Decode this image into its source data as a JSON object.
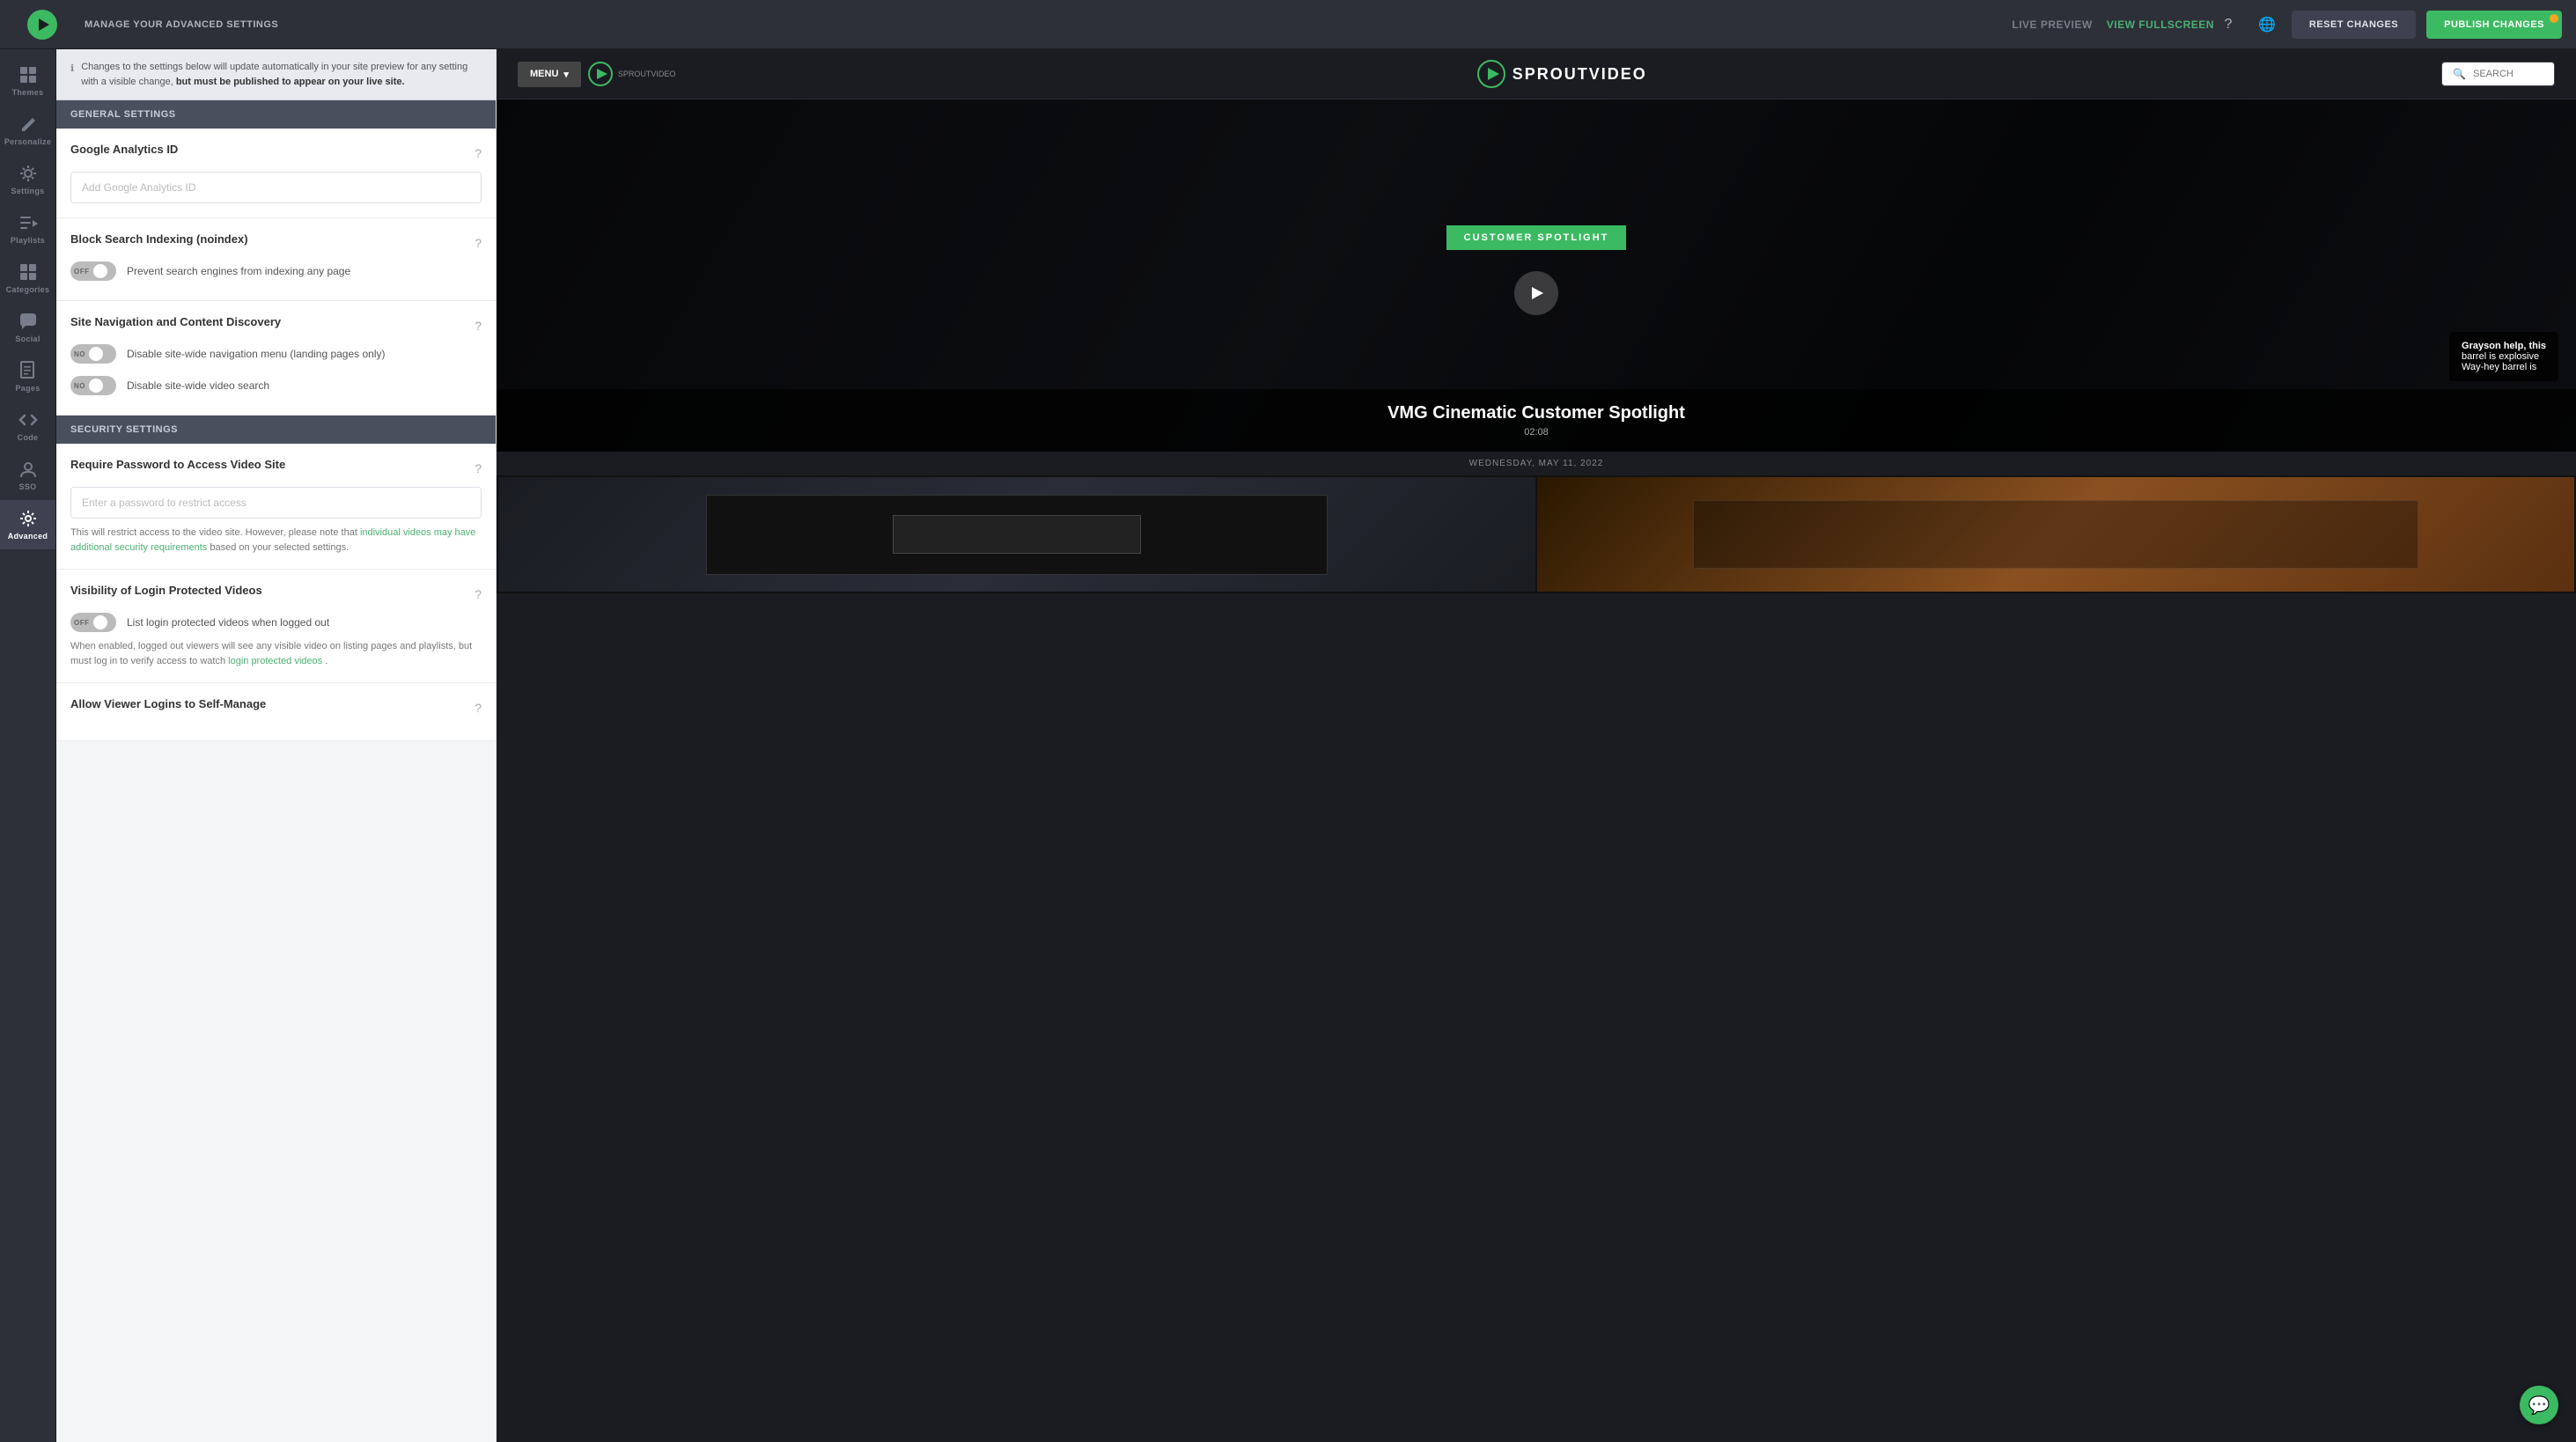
{
  "header": {
    "title": "MANAGE YOUR ADVANCED SETTINGS",
    "live_preview_label": "LIVE PREVIEW",
    "view_fullscreen_label": "VIEW FULLSCREEN",
    "reset_label": "RESET CHANGES",
    "publish_label": "PUBLISH CHANGES"
  },
  "sidebar": {
    "items": [
      {
        "id": "themes",
        "label": "Themes",
        "icon": "▶"
      },
      {
        "id": "personalize",
        "label": "Personalize",
        "icon": "✏"
      },
      {
        "id": "settings",
        "label": "Settings",
        "icon": "⚙"
      },
      {
        "id": "playlists",
        "label": "Playlists",
        "icon": "▶"
      },
      {
        "id": "categories",
        "label": "Categories",
        "icon": "⬛"
      },
      {
        "id": "social",
        "label": "Social",
        "icon": "💬"
      },
      {
        "id": "pages",
        "label": "Pages",
        "icon": "📄"
      },
      {
        "id": "code",
        "label": "Code",
        "icon": "<>"
      },
      {
        "id": "sso",
        "label": "SSO",
        "icon": "🔑"
      },
      {
        "id": "advanced",
        "label": "Advanced",
        "icon": "⬛",
        "active": true
      }
    ]
  },
  "info_bar": {
    "text_before": "Changes to the settings below will update automatically in your site preview for any setting with a visible change, ",
    "text_bold": "but must be published to appear on your live site.",
    "text_after": ""
  },
  "sections": {
    "general": {
      "title": "General Settings",
      "google_analytics": {
        "label": "Google Analytics ID",
        "placeholder": "Add Google Analytics ID"
      },
      "block_search": {
        "label": "Block Search Indexing (noindex)",
        "toggle_state": "OFF",
        "description": "Prevent search engines from indexing any page"
      },
      "site_navigation": {
        "label": "Site Navigation and Content Discovery",
        "toggles": [
          {
            "state": "NO",
            "text": "Disable site-wide navigation menu (landing pages only)"
          },
          {
            "state": "NO",
            "text": "Disable site-wide video search"
          }
        ]
      }
    },
    "security": {
      "title": "Security Settings",
      "password": {
        "label": "Require Password to Access Video Site",
        "placeholder": "Enter a password to restrict access",
        "desc_before": "This will restrict access to the video site. However, please note that ",
        "desc_link": "individual videos may have additional security requirements",
        "desc_after": " based on your selected settings."
      },
      "visibility": {
        "label": "Visibility of Login Protected Videos",
        "toggle_state": "OFF",
        "description": "List login protected videos when logged out",
        "desc_long": "When enabled, logged out viewers will see any visible video on listing pages and playlists, but must log in to verify access to watch ",
        "desc_link": "login protected videos",
        "desc_link_after": "."
      },
      "allow_viewer": {
        "label": "Allow Viewer Logins to Self-Manage"
      }
    }
  },
  "preview": {
    "site_name": "SPROUTVIDEO",
    "menu_label": "MENU",
    "search_placeholder": "SEARCH",
    "hero_badge": "CUSTOMER SPOTLIGHT",
    "hero_title": "VMG Cinematic Customer Spotlight",
    "hero_time": "02:08",
    "hero_date": "WEDNESDAY, MAY 11, 2022",
    "subtitle_line1": "Grayson help, this",
    "subtitle_line2": "barrel is explosive",
    "subtitle_line3": "Way-hey barrel is"
  }
}
